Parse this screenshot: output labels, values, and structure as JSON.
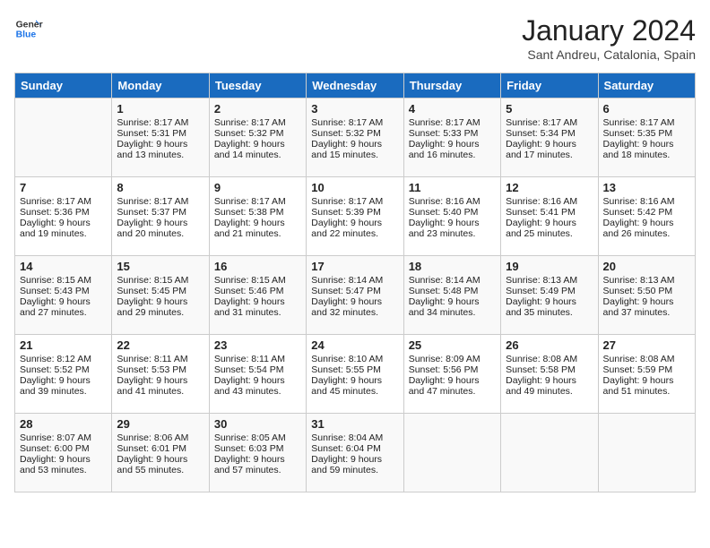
{
  "header": {
    "logo_general": "General",
    "logo_blue": "Blue",
    "title": "January 2024",
    "location": "Sant Andreu, Catalonia, Spain"
  },
  "days_of_week": [
    "Sunday",
    "Monday",
    "Tuesday",
    "Wednesday",
    "Thursday",
    "Friday",
    "Saturday"
  ],
  "weeks": [
    [
      {
        "day": "",
        "info": ""
      },
      {
        "day": "1",
        "info": "Sunrise: 8:17 AM\nSunset: 5:31 PM\nDaylight: 9 hours\nand 13 minutes."
      },
      {
        "day": "2",
        "info": "Sunrise: 8:17 AM\nSunset: 5:32 PM\nDaylight: 9 hours\nand 14 minutes."
      },
      {
        "day": "3",
        "info": "Sunrise: 8:17 AM\nSunset: 5:32 PM\nDaylight: 9 hours\nand 15 minutes."
      },
      {
        "day": "4",
        "info": "Sunrise: 8:17 AM\nSunset: 5:33 PM\nDaylight: 9 hours\nand 16 minutes."
      },
      {
        "day": "5",
        "info": "Sunrise: 8:17 AM\nSunset: 5:34 PM\nDaylight: 9 hours\nand 17 minutes."
      },
      {
        "day": "6",
        "info": "Sunrise: 8:17 AM\nSunset: 5:35 PM\nDaylight: 9 hours\nand 18 minutes."
      }
    ],
    [
      {
        "day": "7",
        "info": "Sunrise: 8:17 AM\nSunset: 5:36 PM\nDaylight: 9 hours\nand 19 minutes."
      },
      {
        "day": "8",
        "info": "Sunrise: 8:17 AM\nSunset: 5:37 PM\nDaylight: 9 hours\nand 20 minutes."
      },
      {
        "day": "9",
        "info": "Sunrise: 8:17 AM\nSunset: 5:38 PM\nDaylight: 9 hours\nand 21 minutes."
      },
      {
        "day": "10",
        "info": "Sunrise: 8:17 AM\nSunset: 5:39 PM\nDaylight: 9 hours\nand 22 minutes."
      },
      {
        "day": "11",
        "info": "Sunrise: 8:16 AM\nSunset: 5:40 PM\nDaylight: 9 hours\nand 23 minutes."
      },
      {
        "day": "12",
        "info": "Sunrise: 8:16 AM\nSunset: 5:41 PM\nDaylight: 9 hours\nand 25 minutes."
      },
      {
        "day": "13",
        "info": "Sunrise: 8:16 AM\nSunset: 5:42 PM\nDaylight: 9 hours\nand 26 minutes."
      }
    ],
    [
      {
        "day": "14",
        "info": "Sunrise: 8:15 AM\nSunset: 5:43 PM\nDaylight: 9 hours\nand 27 minutes."
      },
      {
        "day": "15",
        "info": "Sunrise: 8:15 AM\nSunset: 5:45 PM\nDaylight: 9 hours\nand 29 minutes."
      },
      {
        "day": "16",
        "info": "Sunrise: 8:15 AM\nSunset: 5:46 PM\nDaylight: 9 hours\nand 31 minutes."
      },
      {
        "day": "17",
        "info": "Sunrise: 8:14 AM\nSunset: 5:47 PM\nDaylight: 9 hours\nand 32 minutes."
      },
      {
        "day": "18",
        "info": "Sunrise: 8:14 AM\nSunset: 5:48 PM\nDaylight: 9 hours\nand 34 minutes."
      },
      {
        "day": "19",
        "info": "Sunrise: 8:13 AM\nSunset: 5:49 PM\nDaylight: 9 hours\nand 35 minutes."
      },
      {
        "day": "20",
        "info": "Sunrise: 8:13 AM\nSunset: 5:50 PM\nDaylight: 9 hours\nand 37 minutes."
      }
    ],
    [
      {
        "day": "21",
        "info": "Sunrise: 8:12 AM\nSunset: 5:52 PM\nDaylight: 9 hours\nand 39 minutes."
      },
      {
        "day": "22",
        "info": "Sunrise: 8:11 AM\nSunset: 5:53 PM\nDaylight: 9 hours\nand 41 minutes."
      },
      {
        "day": "23",
        "info": "Sunrise: 8:11 AM\nSunset: 5:54 PM\nDaylight: 9 hours\nand 43 minutes."
      },
      {
        "day": "24",
        "info": "Sunrise: 8:10 AM\nSunset: 5:55 PM\nDaylight: 9 hours\nand 45 minutes."
      },
      {
        "day": "25",
        "info": "Sunrise: 8:09 AM\nSunset: 5:56 PM\nDaylight: 9 hours\nand 47 minutes."
      },
      {
        "day": "26",
        "info": "Sunrise: 8:08 AM\nSunset: 5:58 PM\nDaylight: 9 hours\nand 49 minutes."
      },
      {
        "day": "27",
        "info": "Sunrise: 8:08 AM\nSunset: 5:59 PM\nDaylight: 9 hours\nand 51 minutes."
      }
    ],
    [
      {
        "day": "28",
        "info": "Sunrise: 8:07 AM\nSunset: 6:00 PM\nDaylight: 9 hours\nand 53 minutes."
      },
      {
        "day": "29",
        "info": "Sunrise: 8:06 AM\nSunset: 6:01 PM\nDaylight: 9 hours\nand 55 minutes."
      },
      {
        "day": "30",
        "info": "Sunrise: 8:05 AM\nSunset: 6:03 PM\nDaylight: 9 hours\nand 57 minutes."
      },
      {
        "day": "31",
        "info": "Sunrise: 8:04 AM\nSunset: 6:04 PM\nDaylight: 9 hours\nand 59 minutes."
      },
      {
        "day": "",
        "info": ""
      },
      {
        "day": "",
        "info": ""
      },
      {
        "day": "",
        "info": ""
      }
    ]
  ]
}
